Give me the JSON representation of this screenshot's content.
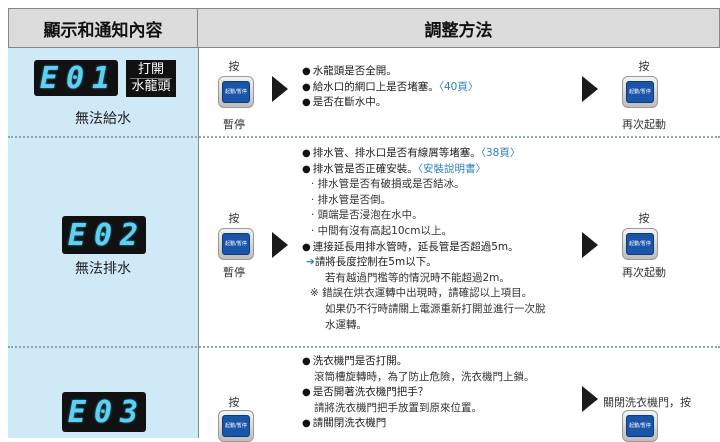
{
  "header": {
    "left_title": "顯示和通知內容",
    "right_title": "調整方法"
  },
  "button_face": "起動/暫停",
  "rows": [
    {
      "code_chars": [
        "E",
        "0",
        "1"
      ],
      "tag_lines": [
        "打開",
        "水龍頭"
      ],
      "name": "無法給水",
      "left_press": "按",
      "left_action": "暫停",
      "right_press": "按",
      "right_action": "再次起動",
      "checks": [
        {
          "kind": "dot",
          "text": "水龍頭是否全開。",
          "ref": ""
        },
        {
          "kind": "dot",
          "text": "給水口的網口上是否堵塞。",
          "ref": "〈40頁〉"
        },
        {
          "kind": "dot",
          "text": "是否在斷水中。",
          "ref": ""
        }
      ]
    },
    {
      "code_chars": [
        "E",
        "0",
        "2"
      ],
      "name": "無法排水",
      "left_press": "按",
      "left_action": "暫停",
      "right_press": "按",
      "right_action": "再次起動",
      "checks": [
        {
          "kind": "dot",
          "text": "排水管、排水口是否有線屑等堵塞。",
          "ref": "〈38頁〉"
        },
        {
          "kind": "dot",
          "text": "排水管是否正確安裝。",
          "ref": "〈安裝說明書〉"
        },
        {
          "kind": "sub",
          "text": "· 排水管是否有破損或是否結冰。",
          "ref": ""
        },
        {
          "kind": "sub",
          "text": "· 排水管是否倒。",
          "ref": ""
        },
        {
          "kind": "sub",
          "text": "· 頭端是否浸泡在水中。",
          "ref": ""
        },
        {
          "kind": "sub",
          "text": "· 中間有沒有高起10cm以上。",
          "ref": ""
        },
        {
          "kind": "dot",
          "text": "連接延長用排水管時，延長管是否超過5m。",
          "ref": ""
        },
        {
          "kind": "arrow",
          "text": "請將長度控制在5m以下。",
          "ref": ""
        },
        {
          "kind": "ind",
          "text": "若有越過門檻等的情況時不能超過2m。",
          "ref": ""
        },
        {
          "kind": "note",
          "text": "※  錯誤在烘衣運轉中出現時，請確認以上項目。",
          "ref": ""
        },
        {
          "kind": "ind",
          "text": "如果仍不行時請關上電源重新打開並進行一次脫",
          "ref": ""
        },
        {
          "kind": "ind",
          "text": "水運轉。",
          "ref": ""
        }
      ]
    },
    {
      "code_chars": [
        "E",
        "0",
        "3"
      ],
      "name": "",
      "left_press": "按",
      "left_action": "",
      "right_press": "關閉洗衣機門，按",
      "right_action": "",
      "checks": [
        {
          "kind": "dot",
          "text": "洗衣機門是否打開。",
          "ref": ""
        },
        {
          "kind": "plain",
          "text": "滾筒槽旋轉時，為了防止危險，洗衣機門上鎖。",
          "ref": ""
        },
        {
          "kind": "dot",
          "text": "是否開著洗衣機門把手？",
          "ref": ""
        },
        {
          "kind": "plain",
          "text": "請將洗衣機門把手放置到原來位置。",
          "ref": ""
        },
        {
          "kind": "dot",
          "text": "請關閉洗衣機門",
          "ref": ""
        }
      ]
    }
  ]
}
